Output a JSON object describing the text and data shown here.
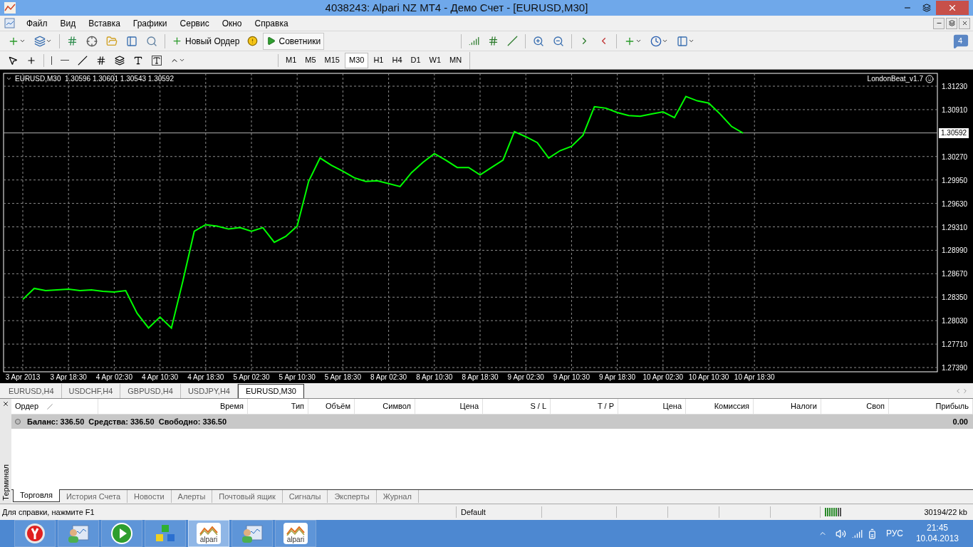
{
  "window": {
    "title": "4038243: Alpari NZ MT4 - Демо Счет - [EURUSD,M30]"
  },
  "menu": [
    "Файл",
    "Вид",
    "Вставка",
    "Графики",
    "Сервис",
    "Окно",
    "Справка"
  ],
  "toolbar": {
    "new_order": "Новый Ордер",
    "experts": "Советники",
    "notification_badge": "4"
  },
  "timeframes": [
    {
      "label": "M1",
      "selected": false
    },
    {
      "label": "M5",
      "selected": false
    },
    {
      "label": "M15",
      "selected": false
    },
    {
      "label": "M30",
      "selected": true
    },
    {
      "label": "H1",
      "selected": false
    },
    {
      "label": "H4",
      "selected": false
    },
    {
      "label": "D1",
      "selected": false
    },
    {
      "label": "W1",
      "selected": false
    },
    {
      "label": "MN",
      "selected": false
    }
  ],
  "chart": {
    "header": "EURUSD,M30  1.30596 1.30601 1.30543 1.30592",
    "expert": "LondonBeat_v1.7",
    "chart_data": {
      "type": "line",
      "grid": true,
      "ref_lines": [
        {
          "axis": "y",
          "value": 1.30592,
          "label": "1.30592"
        }
      ],
      "categories": [
        "3 Apr 2013",
        null,
        null,
        null,
        "3 Apr 18:30",
        null,
        null,
        null,
        "4 Apr 02:30",
        null,
        null,
        null,
        "4 Apr 10:30",
        null,
        null,
        null,
        "4 Apr 18:30",
        null,
        null,
        null,
        "5 Apr 02:30",
        null,
        null,
        null,
        "5 Apr 10:30",
        null,
        null,
        null,
        "5 Apr 18:30",
        null,
        null,
        null,
        "8 Apr 02:30",
        null,
        null,
        null,
        "8 Apr 10:30",
        null,
        null,
        null,
        "8 Apr 18:30",
        null,
        null,
        null,
        "9 Apr 02:30",
        null,
        null,
        null,
        "9 Apr 10:30",
        null,
        null,
        null,
        "9 Apr 18:30",
        null,
        null,
        null,
        "10 Apr 02:30",
        null,
        null,
        null,
        "10 Apr 10:30",
        null,
        null,
        null,
        "10 Apr 18:30",
        null,
        null,
        null,
        null,
        null,
        null,
        null,
        null,
        null,
        null,
        null,
        null,
        null,
        null,
        null,
        null
      ],
      "series": [
        {
          "color": "#00ff00",
          "values": [
            1.2832,
            1.2847,
            1.2844,
            1.2845,
            1.2846,
            1.2844,
            1.2845,
            1.2843,
            1.2842,
            1.2844,
            1.2813,
            1.2793,
            1.2808,
            1.2793,
            1.2857,
            1.2925,
            1.2934,
            1.2932,
            1.2928,
            1.293,
            1.2925,
            1.293,
            1.291,
            1.2918,
            1.2932,
            1.2993,
            1.3025,
            1.3015,
            1.3007,
            1.2998,
            1.2993,
            1.2994,
            1.299,
            1.2986,
            1.3005,
            1.3019,
            1.3031,
            1.3022,
            1.3012,
            1.3012,
            1.3002,
            1.3012,
            1.3022,
            1.3061,
            1.3054,
            1.3046,
            1.3025,
            1.3035,
            1.3041,
            1.3056,
            1.3095,
            1.3093,
            1.3087,
            1.3083,
            1.3082,
            1.3085,
            1.3088,
            1.308,
            1.3109,
            1.3103,
            1.31,
            1.3085,
            1.3068,
            1.3059,
            null,
            null,
            null,
            null,
            null,
            null,
            null,
            null,
            null,
            null,
            null,
            null,
            null,
            null,
            null,
            null,
            null
          ]
        }
      ],
      "ylim": [
        1.27332,
        1.31405
      ],
      "yticks": [
        {
          "value": 1.3123,
          "label": "1.31230"
        },
        {
          "value": 1.3091,
          "label": "1.30910"
        },
        {
          "value": 1.3027,
          "label": "1.30270"
        },
        {
          "value": 1.2995,
          "label": "1.29950"
        },
        {
          "value": 1.2963,
          "label": "1.29630"
        },
        {
          "value": 1.2931,
          "label": "1.29310"
        },
        {
          "value": 1.2899,
          "label": "1.28990"
        },
        {
          "value": 1.2867,
          "label": "1.28670"
        },
        {
          "value": 1.2835,
          "label": "1.28350"
        },
        {
          "value": 1.2803,
          "label": "1.28030"
        },
        {
          "value": 1.2771,
          "label": "1.27710"
        },
        {
          "value": 1.2739,
          "label": "1.27390"
        }
      ]
    }
  },
  "chart_tabs": [
    {
      "label": "EURUSD,H4",
      "selected": false
    },
    {
      "label": "USDCHF,H4",
      "selected": false
    },
    {
      "label": "GBPUSD,H4",
      "selected": false
    },
    {
      "label": "USDJPY,H4",
      "selected": false
    },
    {
      "label": "EURUSD,M30",
      "selected": true
    }
  ],
  "terminal": {
    "title": "Терминал",
    "columns": [
      "Ордер",
      "Время",
      "Тип",
      "Объём",
      "Символ",
      "Цена",
      "S / L",
      "T / P",
      "Цена",
      "Комиссия",
      "Налоги",
      "Своп",
      "Прибыль"
    ],
    "balance": "Баланс: 336.50  Средства: 336.50  Свободно: 336.50",
    "profit": "0.00",
    "tabs": [
      {
        "label": "Торговля",
        "selected": true
      },
      {
        "label": "История Счета",
        "selected": false
      },
      {
        "label": "Новости",
        "selected": false
      },
      {
        "label": "Алерты",
        "selected": false
      },
      {
        "label": "Почтовый ящик",
        "selected": false
      },
      {
        "label": "Сигналы",
        "selected": false
      },
      {
        "label": "Эксперты",
        "selected": false
      },
      {
        "label": "Журнал",
        "selected": false
      }
    ]
  },
  "status_bar": {
    "help": "Для справки, нажмите F1",
    "profile": "Default",
    "traffic": "30194/22 kb"
  },
  "taskbar": {
    "apps": [
      {
        "kind": "browser",
        "selected": false
      },
      {
        "kind": "terminal",
        "selected": false
      },
      {
        "kind": "player",
        "selected": false
      },
      {
        "kind": "blocks",
        "selected": false
      },
      {
        "kind": "alpari",
        "label": "alpari",
        "selected": true
      },
      {
        "kind": "terminal",
        "selected": false
      },
      {
        "kind": "alpari",
        "label": "alpari",
        "selected": false
      }
    ],
    "language": "РУС",
    "time": "21:45",
    "date": "10.04.2013"
  }
}
